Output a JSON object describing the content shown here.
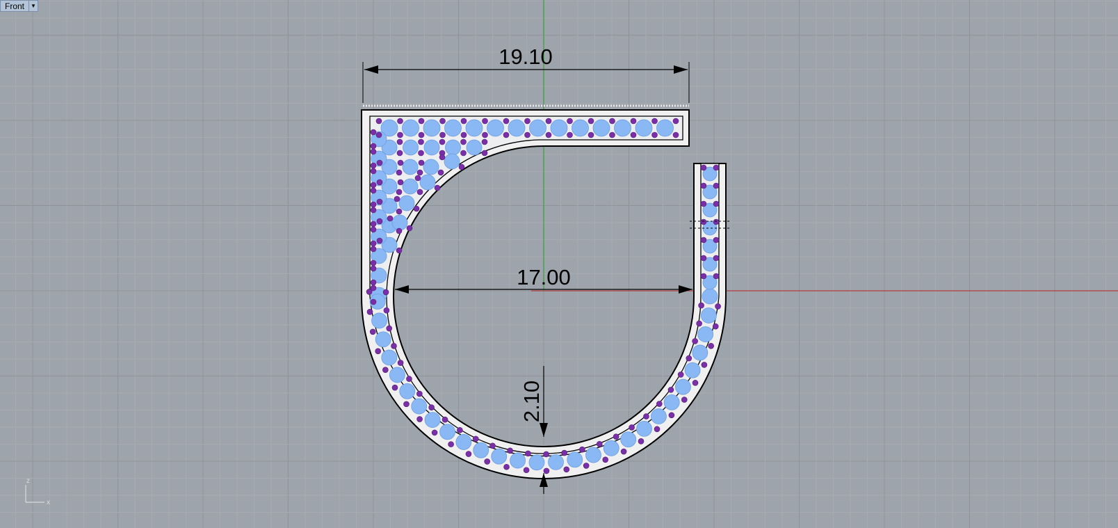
{
  "viewport": {
    "name": "Front",
    "menu_icon": "triangle-down"
  },
  "dimensions": {
    "top_width": "19.10",
    "inner_diameter": "17.00",
    "band_thickness": "2.10"
  },
  "axes_icon": {
    "vertical_label": "z",
    "horizontal_label": "x"
  },
  "colors": {
    "background": "#9ea4ab",
    "grid_minor": "#a5abb1",
    "grid_major": "#8d9399",
    "x_axis": "#b23c3c",
    "z_axis": "#3f9b3f",
    "metal": "#f0f0f0",
    "stone_main": "#8ab8f5",
    "stone_accent": "#7a2fa8"
  }
}
